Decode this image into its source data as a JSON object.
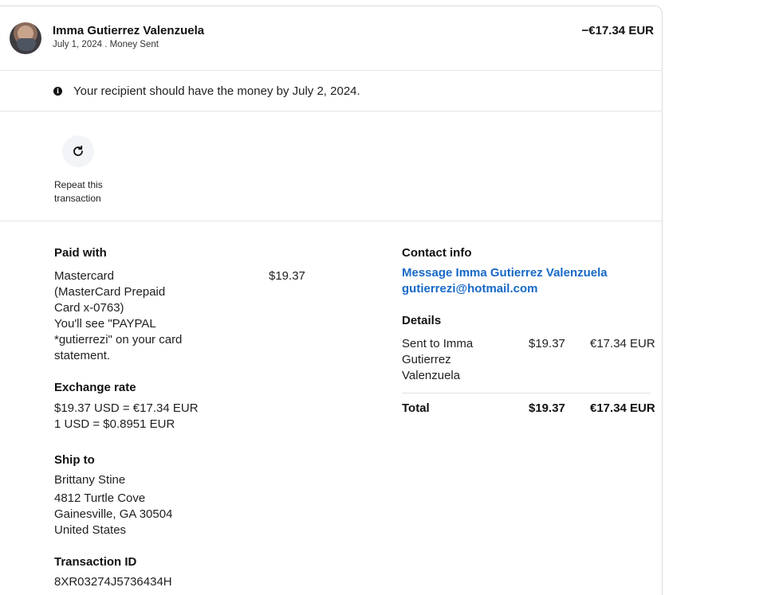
{
  "header": {
    "name": "Imma Gutierrez Valenzuela",
    "subtitle": "July 1, 2024 . Money Sent",
    "amount": "−€17.34 EUR"
  },
  "notice": {
    "icon": "info-icon",
    "text": "Your recipient should have the money by July 2, 2024."
  },
  "repeat": {
    "icon": "refresh-icon",
    "label_line1": "Repeat this",
    "label_line2": "transaction"
  },
  "paid_with": {
    "heading": "Paid with",
    "lines": [
      "Mastercard",
      "(MasterCard Prepaid",
      "Card x-0763)",
      "You'll see \"PAYPAL",
      "*gutierrezi\" on your card",
      "statement."
    ],
    "amount": "$19.37"
  },
  "exchange": {
    "heading": "Exchange rate",
    "line1": "$19.37 USD = €17.34 EUR",
    "line2": "1 USD = $0.8951 EUR"
  },
  "ship_to": {
    "heading": "Ship to",
    "name": "Brittany Stine",
    "address1": "4812 Turtle Cove",
    "address2": "Gainesville, GA 30504",
    "country": "United States"
  },
  "transaction": {
    "heading": "Transaction ID",
    "id": "8XR03274J5736434H"
  },
  "contact": {
    "heading": "Contact info",
    "message_link": "Message Imma Gutierrez Valenzuela",
    "email_link": "gutierrezi@hotmail.com"
  },
  "details": {
    "heading": "Details",
    "row_label_lines": [
      "Sent to Imma",
      "Gutierrez",
      "Valenzuela"
    ],
    "row_usd": "$19.37",
    "row_eur": "€17.34 EUR",
    "total_label": "Total",
    "total_usd": "$19.37",
    "total_eur": "€17.34 EUR"
  }
}
